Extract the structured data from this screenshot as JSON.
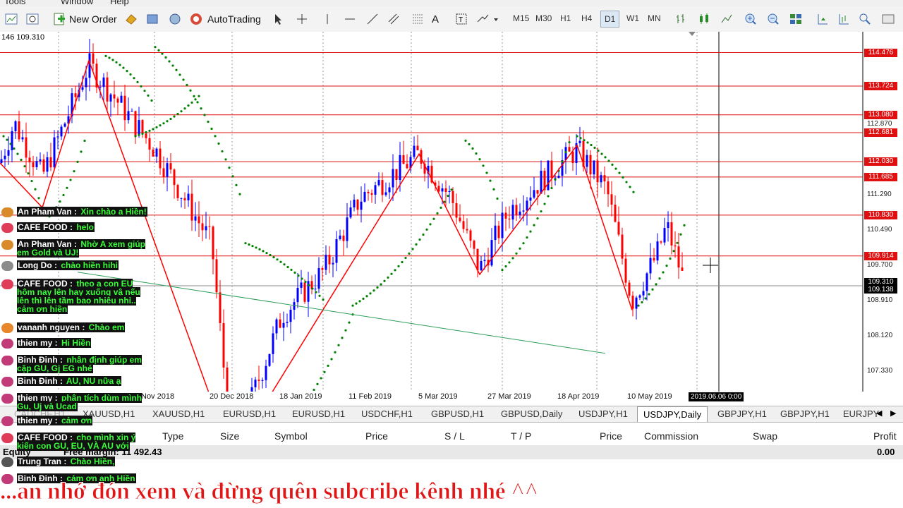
{
  "menu": [
    "Tools",
    "Window",
    "Help"
  ],
  "toolbar": {
    "new_order": "New Order",
    "autotrading": "AutoTrading",
    "timeframes": [
      "M15",
      "M30",
      "H1",
      "H4",
      "D1",
      "W1",
      "MN"
    ]
  },
  "chart": {
    "symbol_period": "USDJPY,Daily",
    "corner_info": "146 109.310",
    "price_levels_red": [
      {
        "label": "114.476",
        "price": 114.476
      },
      {
        "label": "113.724",
        "price": 113.724
      },
      {
        "label": "113.080",
        "price": 113.08
      },
      {
        "label": "112.681",
        "price": 112.681
      },
      {
        "label": "112.030",
        "price": 112.03
      },
      {
        "label": "111.685",
        "price": 111.685
      },
      {
        "label": "110.830",
        "price": 110.83
      },
      {
        "label": "109.914",
        "price": 109.914
      }
    ],
    "price_scale": [
      "112.870",
      "111.290",
      "110.490",
      "109.700",
      "108.910",
      "108.120",
      "107.330"
    ],
    "bid_ask": [
      "109.310",
      "109.138"
    ],
    "date_axis": [
      "Nov 2018",
      "20 Dec 2018",
      "18 Jan 2019",
      "11 Feb 2019",
      "5 Mar 2019",
      "27 Mar 2019",
      "18 Apr 2019",
      "10 May 2019"
    ],
    "crosshair_date": "2019.06.06 0:00",
    "colors": {
      "up": "#0000ff",
      "down": "#ff0000",
      "sar": "#008000",
      "trendline": "#2e9e5b",
      "zigzag": "#ff0000",
      "level": "#e01010"
    }
  },
  "tabs": [
    "CADCHF,H1",
    "XAUUSD,H1",
    "XAUUSD,H1",
    "EURUSD,H1",
    "EURUSD,H1",
    "USDCHF,H1",
    "GBPUSD,H1",
    "GBPUSD,Daily",
    "USDJPY,H1",
    "USDJPY,Daily",
    "GBPJPY,H1",
    "GBPJPY,H1",
    "EURJPY"
  ],
  "active_tab": "USDJPY,Daily",
  "terminal": {
    "headers": [
      "Type",
      "Size",
      "Symbol",
      "Price",
      "S / L",
      "T / P",
      "Price",
      "Commission",
      "Swap",
      "Profit"
    ],
    "equity_label": "Equity",
    "free_margin": "Free margin: 11 492.43",
    "profit": "0.00"
  },
  "chat": [
    {
      "name": "An Pham Van :",
      "text": "Xin chào a Hiền!",
      "avatar": "#d98a2a"
    },
    {
      "name": "CAFE FOOD :",
      "text": "helo",
      "avatar": "#e03c5a"
    },
    {
      "name": "An Pham Van :",
      "text": "Nhờ A xem giúp em Gold và UJ!",
      "avatar": "#d98a2a"
    },
    {
      "name": "Long Do :",
      "text": "chào hiền hihi",
      "avatar": "#8c8c8c"
    },
    {
      "name": "CAFE FOOD :",
      "text": "theo a con EU hôm nay lên hay xuống vậ nếu lên thì lên tầm bao nhiêu nhỉ.. cảm ơn hiền",
      "avatar": "#e03c5a"
    },
    {
      "name": "vananh nguyen :",
      "text": "Chào em",
      "avatar": "#e8862c"
    },
    {
      "name": "thien my :",
      "text": "Hi Hiền",
      "avatar": "#c23a78"
    },
    {
      "name": "Binh Đinh :",
      "text": "nhận định giúp em cặp GU, Gj EG nhé",
      "avatar": "#c23a78"
    },
    {
      "name": "Binh Đinh :",
      "text": "AU, NU nữa ạ",
      "avatar": "#c23a78"
    },
    {
      "name": "thien my :",
      "text": "phân tích dùm mình Gu, Uj và Ucad",
      "avatar": "#c23a78"
    },
    {
      "name": "thien my :",
      "text": "cảm ơn",
      "avatar": "#c23a78"
    },
    {
      "name": "CAFE FOOD :",
      "text": "cho mình xin ý kiến con GU, EU, VÀ AU với",
      "avatar": "#e03c5a"
    },
    {
      "name": "Trung Tran :",
      "text": "Chào Hiền,",
      "avatar": "#555555"
    },
    {
      "name": "Binh Đinh :",
      "text": "cảm ơn anh Hiền",
      "avatar": "#c23a78"
    }
  ],
  "banner": "...an nhớ đón xem và đừng quên subcribe kênh nhé ^^"
}
